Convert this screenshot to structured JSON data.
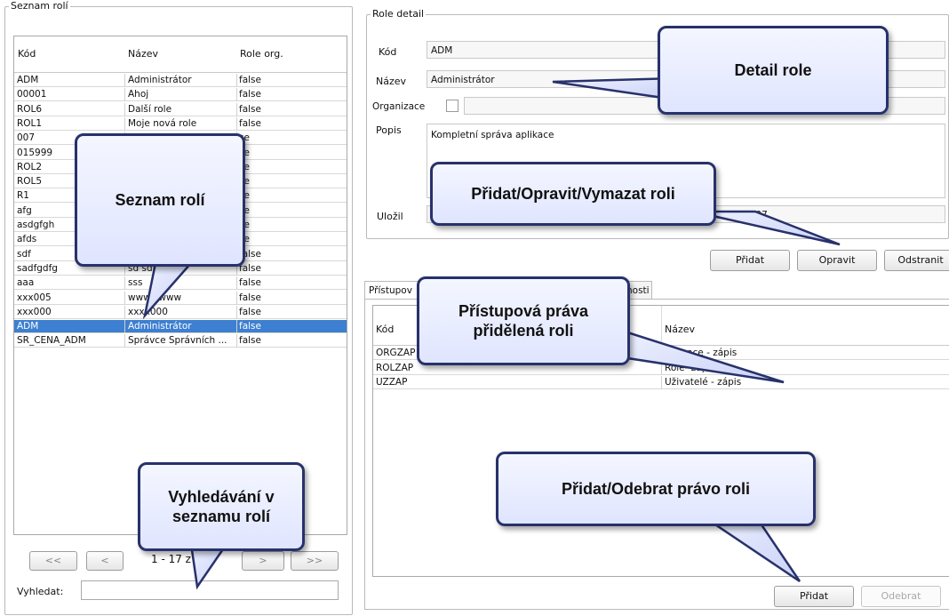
{
  "left_panel": {
    "legend": "Seznam rolí",
    "columns": [
      "Kód",
      "Název",
      "Role org."
    ],
    "rows": [
      [
        "ADM",
        "Administrátor",
        "false"
      ],
      [
        "00001",
        "Ahoj",
        "false"
      ],
      [
        "ROL6",
        "Další role",
        "false"
      ],
      [
        "ROL1",
        "Moje nová role",
        "false"
      ],
      [
        "007",
        "",
        "se"
      ],
      [
        "015999",
        "",
        "se"
      ],
      [
        "ROL2",
        "",
        "se"
      ],
      [
        "ROL5",
        "",
        "se"
      ],
      [
        "R1",
        "",
        "se"
      ],
      [
        "afg",
        "",
        "se"
      ],
      [
        "asdgfgh",
        "",
        "se"
      ],
      [
        "afds",
        "",
        "se"
      ],
      [
        "sdf",
        "gsd",
        "false"
      ],
      [
        "sadfgdfg",
        "sd  sdfg",
        "false"
      ],
      [
        "aaa",
        "sss",
        "false"
      ],
      [
        "xxx005",
        "wwwwwww",
        "false"
      ],
      [
        "xxx000",
        "xxxx000",
        "false"
      ],
      [
        "ADM",
        "Administrátor",
        "false"
      ],
      [
        "SR_CENA_ADM",
        "Správce Správních ...",
        "false"
      ]
    ],
    "selected_row": 17,
    "pager": {
      "first": "<<",
      "prev": "<",
      "info": "1 - 17 z 1",
      "next": ">",
      "last": ">>"
    },
    "search_label": "Vyhledat:",
    "search_value": ""
  },
  "detail": {
    "legend": "Role detail",
    "kod_label": "Kód",
    "kod_value": "ADM",
    "nazev_label": "Název",
    "nazev_value": "Administrátor",
    "org_label": "Organizace",
    "popis_label": "Popis",
    "popis_value": "Kompletní správa aplikace",
    "ulozil_label": "Uložil",
    "ulozil_value": "17.dec-07",
    "buttons": {
      "add": "Přidat",
      "edit": "Opravit",
      "delete": "Odstranit"
    }
  },
  "rights": {
    "tab_left": "Přístupov",
    "tab_right": "nosti",
    "columns": [
      "Kód",
      "Název"
    ],
    "rows": [
      [
        "ORGZAP",
        "...nizace - zápis"
      ],
      [
        "ROLZAP",
        "Role- zápis"
      ],
      [
        "UZZAP",
        "Uživatelé - zápis"
      ]
    ],
    "buttons": {
      "add": "Přidat",
      "remove": "Odebrat"
    }
  },
  "callouts": {
    "detail_role": "Detail role",
    "seznam_roli": "Seznam rolí",
    "pridat_opravit": "Přidat/Opravit/Vymazat roli",
    "pristupova_1": "Přístupová práva",
    "pristupova_2": "přidělená roli",
    "pridat_odebrat": "Přidat/Odebrat právo roli",
    "vyhledavani_1": "Vyhledávání v",
    "vyhledavani_2": "seznamu rolí"
  },
  "colors": {
    "selection": "#3d7fd0",
    "callout_border": "#27316b"
  }
}
